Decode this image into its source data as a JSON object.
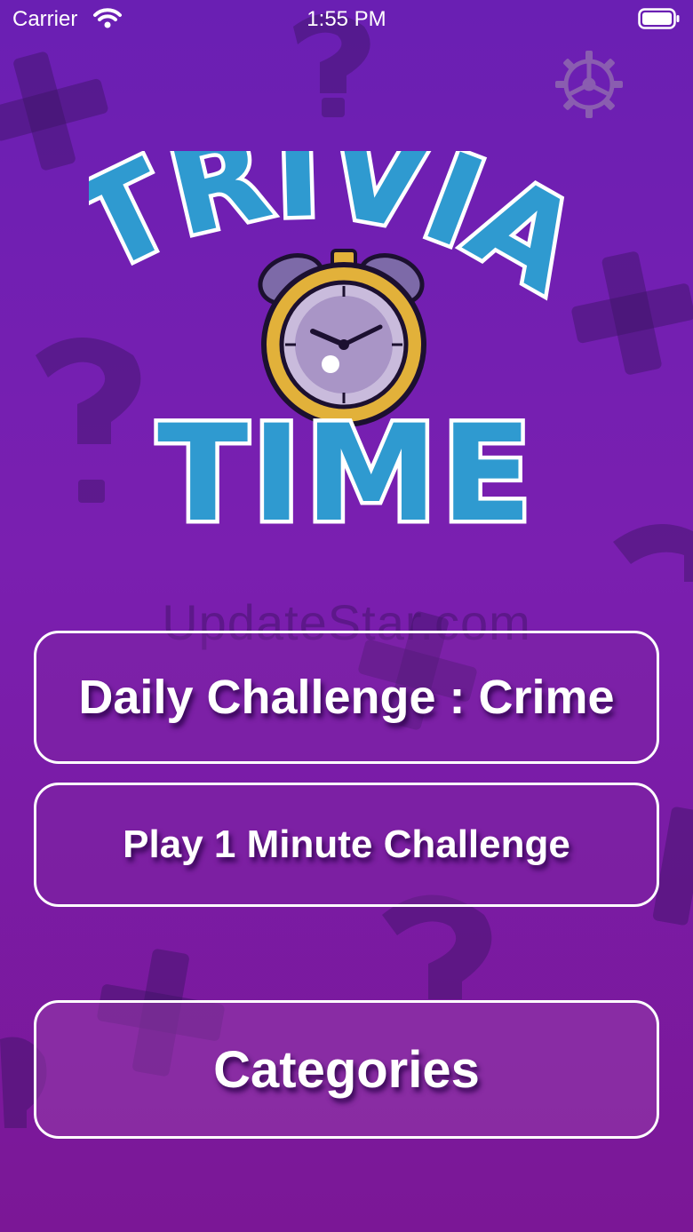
{
  "status_bar": {
    "carrier": "Carrier",
    "time": "1:55 PM"
  },
  "logo": {
    "line1": "TRIVIA",
    "line2": "TIME"
  },
  "watermark": "UpdateStar.com",
  "buttons": {
    "daily": "Daily Challenge : Crime",
    "minute": "Play 1 Minute Challenge",
    "categories": "Categories"
  },
  "colors": {
    "background_top": "#6a1fb3",
    "background_bottom": "#7b1796",
    "logo_blue": "#2f9ad0",
    "clock_gold": "#e2b13a",
    "bell_purple": "#7d6aa8"
  },
  "icons": {
    "settings": "gear-icon",
    "wifi": "wifi-icon",
    "battery": "battery-icon",
    "clock": "alarm-clock-icon"
  }
}
